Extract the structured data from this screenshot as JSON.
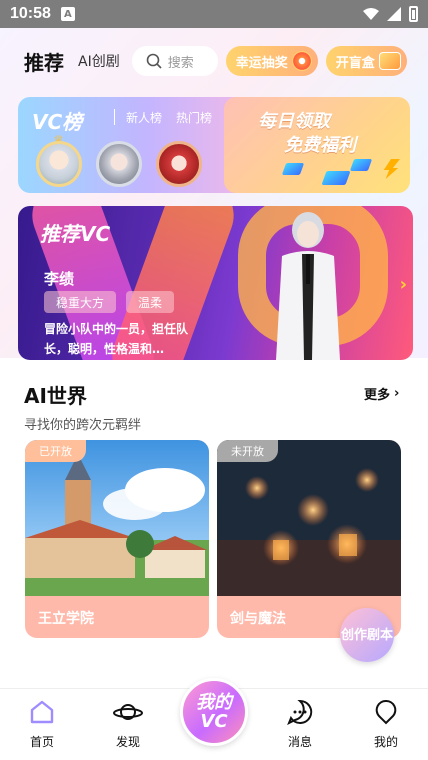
{
  "status_bar": {
    "time": "10:58",
    "notification_icon": "A"
  },
  "header": {
    "title": "推荐",
    "tab_ai": "AI创剧",
    "search_placeholder": "搜索",
    "lottery_label": "幸运抽奖",
    "blindbox_label": "开盲盒"
  },
  "rank_card": {
    "logo": "VC榜",
    "tabs": [
      "新人榜",
      "热门榜"
    ]
  },
  "welfare_card": {
    "line1": "每日领取",
    "line2": "免费福利"
  },
  "banner": {
    "title": "推荐VC",
    "character_name": "李绩",
    "tags": [
      "稳重大方",
      "温柔"
    ],
    "description": "冒险小队中的一员，担任队长，聪明，性格温和…"
  },
  "ai_world": {
    "title": "AI世界",
    "more": "更多",
    "subtitle": "寻找你的跨次元羁绊",
    "cards": [
      {
        "badge": "已开放",
        "name": "王立学院"
      },
      {
        "badge": "未开放",
        "name": "剑与魔法"
      }
    ],
    "create_button": "创作剧本"
  },
  "bottom_nav": {
    "home": "首页",
    "discover": "发现",
    "center": "我的VC",
    "messages": "消息",
    "mine": "我的"
  },
  "colors": {
    "accent_pink": "#ffb9ab",
    "accent_orange": "#ffb07a",
    "banner_purple": "#5a2bb0"
  }
}
